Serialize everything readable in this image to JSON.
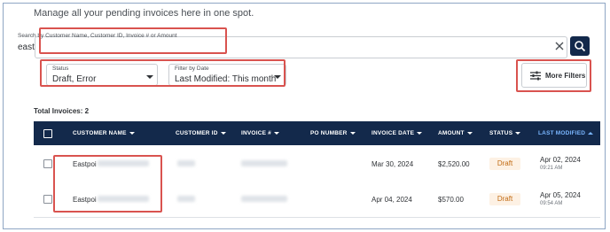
{
  "intro_text": "Manage all your pending invoices here in one spot.",
  "search": {
    "label": "Search by Customer Name, Customer ID, Invoice # or Amount",
    "value": "east",
    "clear_icon": "close-icon",
    "button_icon": "search-icon"
  },
  "filters": {
    "status": {
      "label": "Status",
      "value": "Draft, Error"
    },
    "date": {
      "label": "Filter by Date",
      "value": "Last Modified: This month"
    },
    "more_filters": {
      "label": "More Filters",
      "icon": "sliders-icon"
    }
  },
  "total_label": "Total Invoices: 2",
  "table": {
    "columns": [
      {
        "label": "CUSTOMER NAME",
        "active": false
      },
      {
        "label": "CUSTOMER ID",
        "active": false
      },
      {
        "label": "INVOICE #",
        "active": false
      },
      {
        "label": "PO NUMBER",
        "active": false
      },
      {
        "label": "INVOICE DATE",
        "active": false
      },
      {
        "label": "AMOUNT",
        "active": false
      },
      {
        "label": "STATUS",
        "active": false
      },
      {
        "label": "LAST MODIFIED",
        "active": true
      }
    ],
    "rows": [
      {
        "customer_name": "Eastpoi",
        "invoice_date": "Mar 30, 2024",
        "amount": "$2,520.00",
        "status": "Draft",
        "last_modified_date": "Apr 02, 2024",
        "last_modified_time": "09:21 AM"
      },
      {
        "customer_name": "Eastpoi",
        "invoice_date": "Apr 04, 2024",
        "amount": "$570.00",
        "status": "Draft",
        "last_modified_date": "Apr 05, 2024",
        "last_modified_time": "09:54 AM"
      }
    ]
  },
  "colors": {
    "header_bg": "#13294b",
    "active_sort": "#7ab6ff",
    "highlight": "#d9534f",
    "draft_badge_bg": "#fdf1e4",
    "draft_badge_text": "#c16a12"
  }
}
